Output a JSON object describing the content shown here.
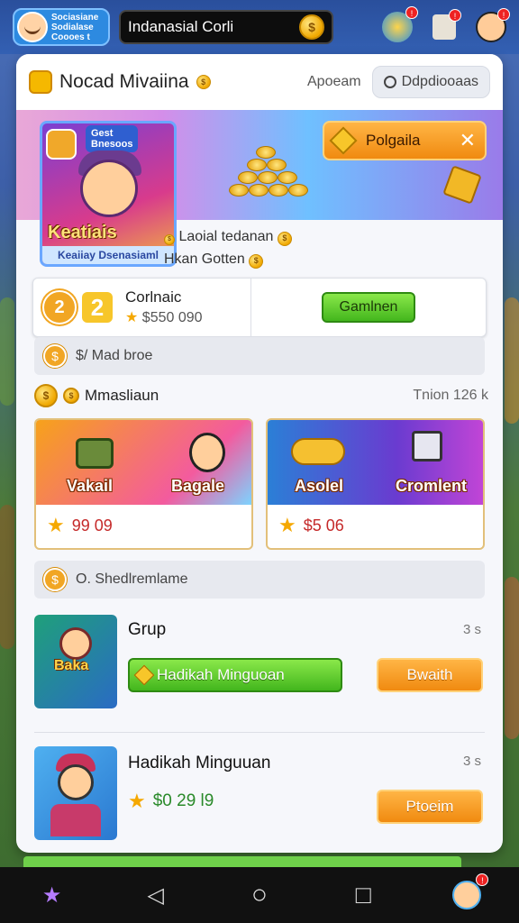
{
  "topbar": {
    "profile_line1": "Sociasiane",
    "profile_line2": "Sodialase",
    "profile_line3": "Coooes t",
    "search_value": "Indanasial Corli",
    "notif_badge_1": "!",
    "notif_badge_2": "!",
    "notif_badge_3": "!"
  },
  "panel": {
    "title": "Nocad Mivaiina",
    "link": "Apoeam",
    "head_button": "Ddpdiooaas"
  },
  "banner": {
    "card_tag_line1": "Gest",
    "card_tag_line2": "Bnesoos",
    "card_title": "Keatiais",
    "card_caption": "Keaiiay Dsenasiaml",
    "button_label": "Polgaila",
    "close_symbol": "✕",
    "info_line1": "Laoial tedanan",
    "info_line2": "Hkan Gotten"
  },
  "exchange": {
    "badge1": "2",
    "badge2": "2",
    "title": "Corlnaic",
    "value": "$550 090",
    "button": "Gamlnen"
  },
  "strip1": {
    "icon": "$",
    "label": "$/ Mad broe"
  },
  "section": {
    "title": "Mmasliaun",
    "right": "Tnion 126 k"
  },
  "products": [
    {
      "left_label": "Vakail",
      "right_label": "Bagale",
      "price": "99 09"
    },
    {
      "left_label": "Asolel",
      "right_label": "Cromlent",
      "price": "$5 06"
    }
  ],
  "strip2": {
    "icon": "$",
    "label": "O. Shedlremlame"
  },
  "list": [
    {
      "thumb_text": "Baka",
      "title": "Grup",
      "meta": "3 s",
      "green_button": "Hadikah Minguoan",
      "orange_button": "Bwaith"
    },
    {
      "title": "Hadikah Minguuan",
      "meta": "3 s",
      "price": "$0 29 l9",
      "orange_button": "Ptoeim"
    }
  ],
  "navbar": {
    "home_icon": "★",
    "back_icon": "◁",
    "circle_icon": "○",
    "square_icon": "□",
    "badge": "!"
  }
}
